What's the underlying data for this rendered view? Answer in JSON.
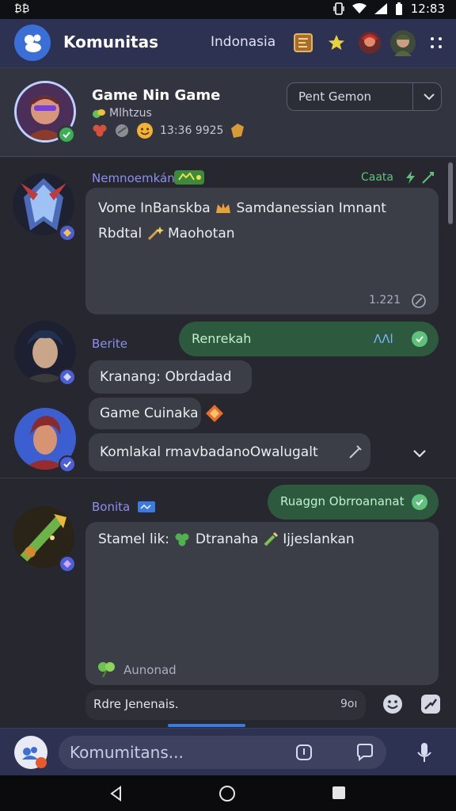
{
  "status_bar": {
    "left_text": "₿₿",
    "time": "12:83"
  },
  "app_bar": {
    "title": "Komunitas",
    "region": "Indonasia"
  },
  "group": {
    "name": "Game Nin Game",
    "subtitle": "Mlhtzus",
    "meta_time": "13:36 9925",
    "select": {
      "value": "Pent Gemon"
    }
  },
  "messages": [
    {
      "sender": "Nemnoemkán",
      "status": "Caata",
      "text_line1": "Vome InBanskba",
      "text_line1b": "Samdanessian Imnant",
      "text_line2": "Rbdtal",
      "text_line2b": "Maohotan",
      "timestamp": "1.221"
    },
    {
      "sender": "Berite",
      "green_label": "Renrekah",
      "green_meta": "ɅɅl",
      "bubble_text": "Kranang: Obrdadad"
    },
    {
      "bubble_text": "Game Cuinaka",
      "input_text": "Komlakal rmavbadanoOwalugalt"
    },
    {
      "sender": "Bonita",
      "green_label": "Ruaggn Obrroananat",
      "text_line1": "Stamel lik:",
      "text_line1b": "Dtranaha",
      "text_line1c": "Ijjeslankan",
      "footer_text": "Aunonad",
      "reply_text": "Rdre Jenenais.",
      "reply_count": "9oı"
    }
  ],
  "compose": {
    "placeholder": "Komumitans..."
  },
  "colors": {
    "appbar": "#2e3252",
    "accent_green": "#5ec27a",
    "sender_purple": "#8d8ff0"
  }
}
